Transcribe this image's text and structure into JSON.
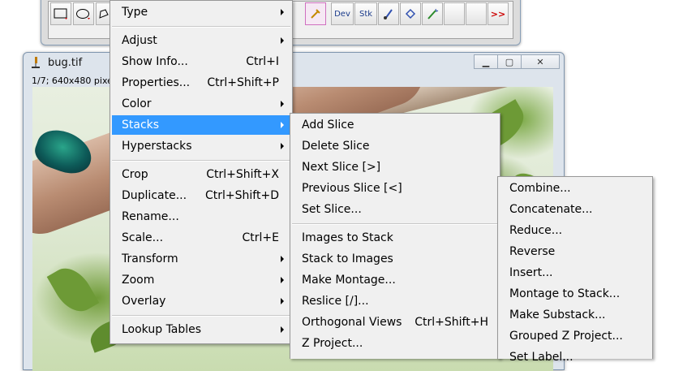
{
  "image_window": {
    "title": "bug.tif",
    "info": "1/7; 640x480 pixe"
  },
  "toolbar": {
    "dev_label": "Dev",
    "stk_label": "Stk",
    "more_label": ">>",
    "accent_color": "#cc0000"
  },
  "image_menu": {
    "items": [
      {
        "label": "Type",
        "submenu": true
      },
      {
        "label": "Adjust",
        "submenu": true
      },
      {
        "label": "Show Info...",
        "shortcut": "Ctrl+I"
      },
      {
        "label": "Properties...",
        "shortcut": "Ctrl+Shift+P"
      },
      {
        "label": "Color",
        "submenu": true
      },
      {
        "label": "Stacks",
        "submenu": true,
        "highlighted": true
      },
      {
        "label": "Hyperstacks",
        "submenu": true
      },
      {
        "label": "Crop",
        "shortcut": "Ctrl+Shift+X"
      },
      {
        "label": "Duplicate...",
        "shortcut": "Ctrl+Shift+D"
      },
      {
        "label": "Rename..."
      },
      {
        "label": "Scale...",
        "shortcut": "Ctrl+E"
      },
      {
        "label": "Transform",
        "submenu": true
      },
      {
        "label": "Zoom",
        "submenu": true
      },
      {
        "label": "Overlay",
        "submenu": true
      },
      {
        "label": "Lookup Tables",
        "submenu": true
      }
    ]
  },
  "stacks_menu": {
    "items": [
      {
        "label": "Add Slice"
      },
      {
        "label": "Delete Slice"
      },
      {
        "label": "Next Slice [>]"
      },
      {
        "label": "Previous Slice [<]"
      },
      {
        "label": "Set Slice..."
      },
      {
        "label": "Images to Stack"
      },
      {
        "label": "Stack to Images"
      },
      {
        "label": "Make Montage..."
      },
      {
        "label": "Reslice [/]..."
      },
      {
        "label": "Orthogonal Views",
        "shortcut": "Ctrl+Shift+H"
      },
      {
        "label": "Z Project..."
      }
    ]
  },
  "tools_menu": {
    "items": [
      {
        "label": "Combine..."
      },
      {
        "label": "Concatenate..."
      },
      {
        "label": "Reduce..."
      },
      {
        "label": "Reverse"
      },
      {
        "label": "Insert..."
      },
      {
        "label": "Montage to Stack..."
      },
      {
        "label": "Make Substack..."
      },
      {
        "label": "Grouped Z Project..."
      },
      {
        "label": "Set Label..."
      }
    ]
  },
  "colors": {
    "highlight": "#3399ff",
    "menu_bg": "#f0f0f0"
  }
}
